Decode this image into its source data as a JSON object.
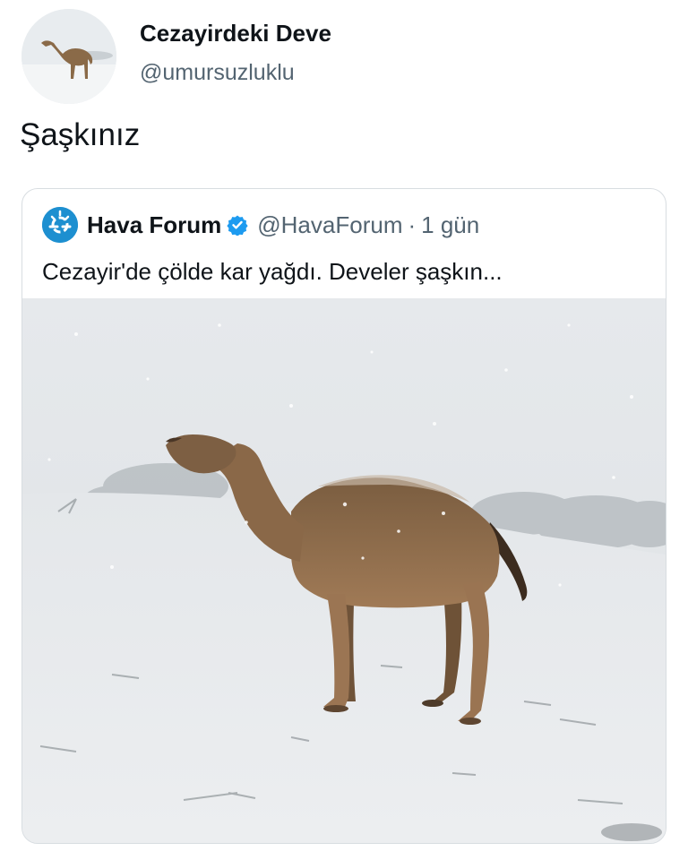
{
  "tweet": {
    "author": {
      "display_name": "Cezayirdeki Deve",
      "handle": "@umursuzluklu",
      "avatar_icon": "camel-avatar-icon"
    },
    "text": "Şaşkınız"
  },
  "quoted_tweet": {
    "author": {
      "display_name": "Hava Forum",
      "handle": "@HavaForum",
      "verified": true,
      "verified_color": "#1d9bf0",
      "avatar_icon": "weather-logo-icon"
    },
    "separator": "·",
    "time": "1 gün",
    "text": "Cezayir'de çölde kar yağdı. Develer şaşkın...",
    "media": {
      "subject_icon": "camel-in-snow-image"
    }
  }
}
